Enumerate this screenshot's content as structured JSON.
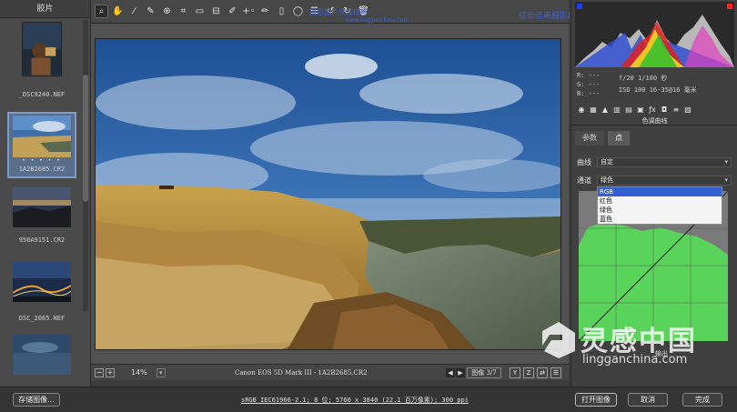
{
  "filmstrip": {
    "header": "胶片",
    "items": [
      {
        "label": "_DSC9240.NEF",
        "stars": ""
      },
      {
        "label": "1A2B2685.CR2",
        "stars": "• • • • •"
      },
      {
        "label": "950A9151.CR2",
        "stars": ""
      },
      {
        "label": "DSC_2065.NEF",
        "stars": ""
      },
      {
        "label": "",
        "stars": ""
      }
    ]
  },
  "toolbar": {
    "tools": [
      "zoom-icon",
      "hand-icon",
      "white-balance-icon",
      "color-sampler-icon",
      "target-adjust-icon",
      "crop-icon",
      "straighten-icon",
      "transform-icon",
      "spot-removal-icon",
      "red-eye-icon",
      "adjustment-brush-icon",
      "graduated-filter-icon",
      "radial-filter-icon",
      "preferences-icon",
      "rotate-left-icon",
      "rotate-right-icon",
      "trash-icon"
    ],
    "watermark_line1": "摄影图片处理技巧",
    "watermark_line2": "www.lingganchina.com",
    "title_overlay": "综合运用摄影后期综合案例技巧培训"
  },
  "preview": {
    "zoom": "14%",
    "camera_info": "Canon EOS 5D Mark III - 1A2B2685.CR2",
    "image_counter": "图像 3/7",
    "view_buttons": [
      "Y",
      "Z"
    ]
  },
  "right_panel": {
    "rgb": {
      "r": "R:  ---",
      "g": "G:  ---",
      "b": "B:  ---"
    },
    "exif": {
      "aperture_shutter": "f/20   1/100 秒",
      "iso_lens": "ISO 100   16-35@16 毫米"
    },
    "panel_title": "色调曲线",
    "tabs": [
      "参数",
      "点"
    ],
    "curve_label": "曲线",
    "curve_value": "自定",
    "channel_label": "通道",
    "channel_value": "绿色",
    "channel_options": [
      "RGB",
      "红色",
      "绿色",
      "蓝色"
    ],
    "output_label": "输出"
  },
  "logo": {
    "cn": "灵感中国",
    "en": "lingganchina.com"
  },
  "bottom": {
    "save_label": "存储图像...",
    "workflow": "sRGB IEC61966-2.1; 8 位; 5760 x 3840 (22.1 百万像素); 300 ppi",
    "open_label": "打开图像",
    "cancel_label": "取消",
    "done_label": "完成"
  },
  "colors": {
    "accent": "#3b62d8",
    "curve_green": "#5ad35a",
    "highlight": "#3060d0"
  }
}
